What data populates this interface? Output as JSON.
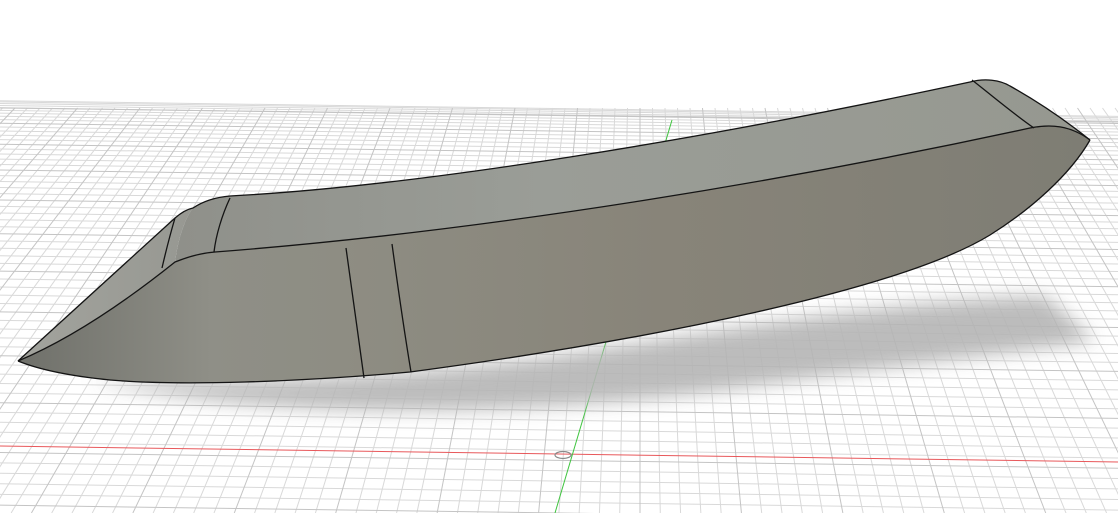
{
  "scene": {
    "view": "3d-viewport",
    "background_color": "#ffffff",
    "grid": {
      "visible": true,
      "minor_line_color": "#d9d9d9",
      "major_line_color": "#c4c4c4"
    },
    "axes": {
      "x_axis_color": "#e8585b",
      "y_axis_color": "#3fc43f",
      "origin_marker": "origin-icon"
    },
    "body": {
      "name": "curved-blade-body",
      "face_colors": {
        "top_face": "#9a9b94",
        "side_face": "#8b8a80",
        "end_cap": "#7f7f77",
        "edge": "#141414"
      },
      "shadow_color": "#b5b5b5"
    }
  }
}
